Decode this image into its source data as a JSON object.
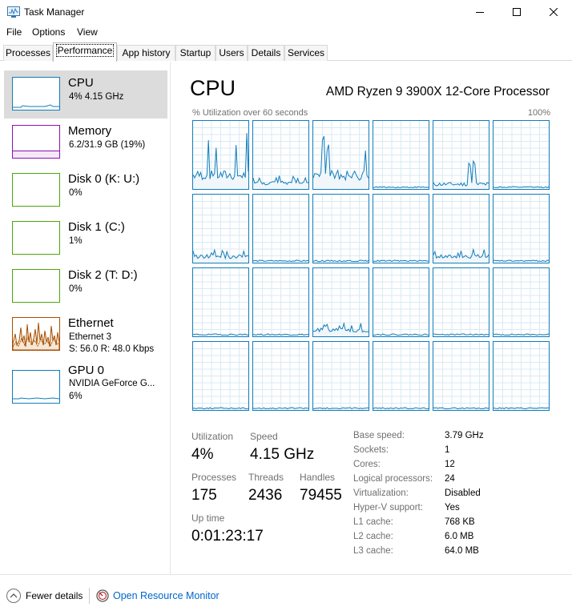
{
  "window": {
    "title": "Task Manager",
    "minimize_icon": "minimize-icon",
    "maximize_icon": "maximize-icon",
    "close_icon": "close-icon"
  },
  "menu": [
    "File",
    "Options",
    "View"
  ],
  "tabs": [
    {
      "label": "Processes",
      "active": false
    },
    {
      "label": "Performance",
      "active": true
    },
    {
      "label": "App history",
      "active": false
    },
    {
      "label": "Startup",
      "active": false
    },
    {
      "label": "Users",
      "active": false
    },
    {
      "label": "Details",
      "active": false
    },
    {
      "label": "Services",
      "active": false
    }
  ],
  "sidebar": [
    {
      "title": "CPU",
      "sub": "4%  4.15 GHz",
      "sub2": "",
      "color": "#117dbb"
    },
    {
      "title": "Memory",
      "sub": "6.2/31.9 GB (19%)",
      "sub2": "",
      "color": "#8b12ae"
    },
    {
      "title": "Disk 0 (K: U:)",
      "sub": "0%",
      "sub2": "",
      "color": "#4da60c"
    },
    {
      "title": "Disk 1 (C:)",
      "sub": "1%",
      "sub2": "",
      "color": "#4da60c"
    },
    {
      "title": "Disk 2 (T: D:)",
      "sub": "0%",
      "sub2": "",
      "color": "#4da60c"
    },
    {
      "title": "Ethernet",
      "sub": "Ethernet 3",
      "sub2": "S: 56.0  R: 48.0 Kbps",
      "color": "#a74f01"
    },
    {
      "title": "GPU 0",
      "sub": "NVIDIA GeForce G...",
      "sub2": "6%",
      "color": "#117dbb"
    }
  ],
  "main": {
    "title": "CPU",
    "processor": "AMD Ryzen 9 3900X 12-Core Processor",
    "util_label": "% Utilization over 60 seconds",
    "util_max": "100%"
  },
  "stats": {
    "utilization_label": "Utilization",
    "utilization_value": "4%",
    "speed_label": "Speed",
    "speed_value": "4.15 GHz",
    "processes_label": "Processes",
    "processes_value": "175",
    "threads_label": "Threads",
    "threads_value": "2436",
    "handles_label": "Handles",
    "handles_value": "79455",
    "uptime_label": "Up time",
    "uptime_value": "0:01:23:17"
  },
  "specs": [
    {
      "label": "Base speed:",
      "value": "3.79 GHz"
    },
    {
      "label": "Sockets:",
      "value": "1"
    },
    {
      "label": "Cores:",
      "value": "12"
    },
    {
      "label": "Logical processors:",
      "value": "24"
    },
    {
      "label": "Virtualization:",
      "value": "Disabled"
    },
    {
      "label": "Hyper-V support:",
      "value": "Yes"
    },
    {
      "label": "L1 cache:",
      "value": "768 KB"
    },
    {
      "label": "L2 cache:",
      "value": "6.0 MB"
    },
    {
      "label": "L3 cache:",
      "value": "64.0 MB"
    }
  ],
  "footer": {
    "fewer_details": "Fewer details",
    "open_resource_monitor": "Open Resource Monitor"
  },
  "colors": {
    "cpu_line": "#117dbb",
    "cpu_fill": "#f1f6fa",
    "memory": "#8b12ae",
    "disk": "#4da60c",
    "ethernet": "#a74f01",
    "link": "#0066cc"
  }
}
